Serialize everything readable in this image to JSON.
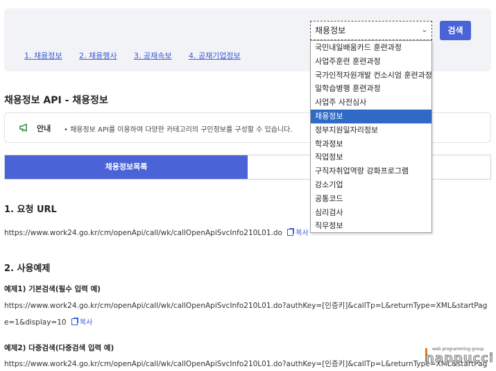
{
  "search": {
    "selected": "채용정보",
    "button_label": "검색",
    "options": [
      "국민내일배움카드 훈련과정",
      "사업주훈련 훈련과정",
      "국가인적자원개발 컨소시엄 훈련과정",
      "일학습병행 훈련과정",
      "사업주 사전심사",
      "채용정보",
      "정부지원일자리정보",
      "학과정보",
      "직업정보",
      "구직자취업역량 강화프로그램",
      "강소기업",
      "공통코드",
      "심리검사",
      "직무정보"
    ],
    "selected_index": 5
  },
  "top_links": [
    "1. 채용정보",
    "2. 채용행사",
    "3. 공채속보",
    "4. 공채기업정보"
  ],
  "page_title": "채용정보 API - 채용정보",
  "notice": {
    "label": "안내",
    "text": "• 채용정보 API를 이용하여 다양한 카테고리의 구인정보를 구성할 수 있습니다."
  },
  "tabs": {
    "active_label": "채용정보목록"
  },
  "sections": {
    "request_url_title": "1. 요청 URL",
    "request_url": "https://www.work24.go.kr/cm/openApi/call/wk/callOpenApiSvcInfo210L01.do",
    "copy_label_cut": "복사",
    "usage_title": "2. 사용예제",
    "ex1_title": "예제1) 기본검색(필수 입력 예)",
    "ex1_line1": "https://www.work24.go.kr/cm/openApi/call/wk/callOpenApiSvcInfo210L01.do?authKey=[인증키]&callTp=L&returnType=XML&startPag",
    "ex1_line2": "e=1&display=10",
    "copy_label": "복사",
    "ex2_title": "예제2) 다중검색(다중검색 입력 예)",
    "ex2_line1": "https://www.work24.go.kr/cm/openApi/call/wk/callOpenApiSvcInfo210L01.do?authKey=[인증키]&callTp=L&returnType=XML&startPag"
  },
  "watermark": {
    "small": "web programming group",
    "logo": "nappucci"
  },
  "colors": {
    "accent": "#4a63d6",
    "selected_option": "#2f6ac7",
    "link": "#3b5bd6"
  }
}
